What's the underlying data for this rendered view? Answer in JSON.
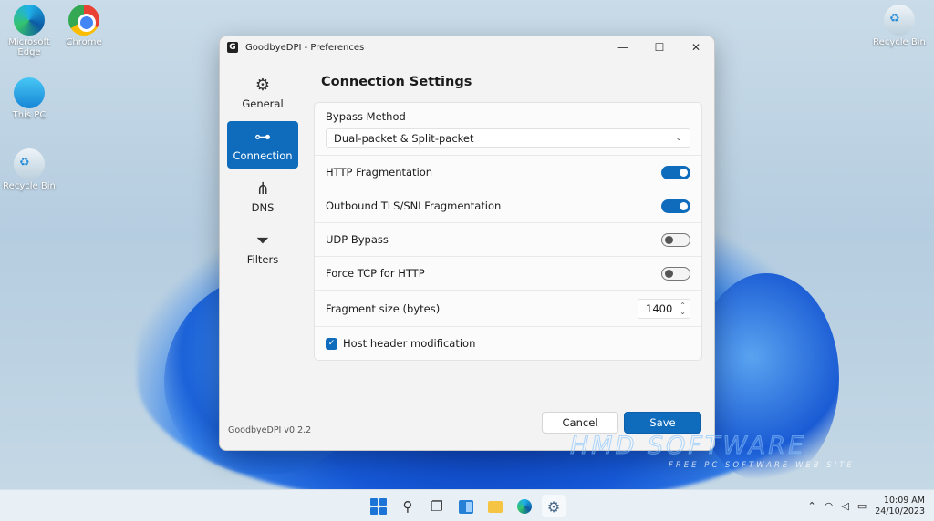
{
  "desktop": {
    "icons": [
      {
        "label": "Microsoft Edge"
      },
      {
        "label": "Chrome"
      },
      {
        "label": "This PC"
      },
      {
        "label": "Recycle Bin"
      },
      {
        "label": "Recycle Bin"
      }
    ]
  },
  "window": {
    "title": "GoodbyeDPI - Preferences",
    "app_icon_letter": "G",
    "controls": {
      "minimize": "—",
      "maximize": "☐",
      "close": "✕"
    }
  },
  "nav": {
    "items": [
      {
        "label": "General",
        "icon": "gear-icon",
        "glyph": "⚙",
        "active": false
      },
      {
        "label": "Connection",
        "icon": "connection-icon",
        "glyph": "⊶",
        "active": true
      },
      {
        "label": "DNS",
        "icon": "network-nodes-icon",
        "glyph": "⋔",
        "active": false
      },
      {
        "label": "Filters",
        "icon": "filter-icon",
        "glyph": "⏷",
        "active": false
      }
    ]
  },
  "version": "GoodbyeDPI v0.2.2",
  "connection": {
    "title": "Connection Settings",
    "bypass_method_label": "Bypass Method",
    "bypass_method_value": "Dual-packet & Split-packet",
    "toggles": [
      {
        "label": "HTTP Fragmentation",
        "on": true
      },
      {
        "label": "Outbound TLS/SNI Fragmentation",
        "on": true
      },
      {
        "label": "UDP Bypass",
        "on": false
      },
      {
        "label": "Force TCP for HTTP",
        "on": false
      }
    ],
    "fragment_size_label": "Fragment size (bytes)",
    "fragment_size_value": "1400",
    "host_header_label": "Host header modification",
    "host_header_checked": true
  },
  "buttons": {
    "cancel": "Cancel",
    "save": "Save"
  },
  "watermark": {
    "main": "HMD SOFTWARE",
    "sub": "FREE PC SOFTWARE WEB SITE"
  },
  "taskbar": {
    "time": "10:09 AM",
    "date": "24/10/2023",
    "tray_icons": [
      "chevron-up-icon",
      "wifi-icon",
      "volume-icon",
      "battery-icon"
    ]
  },
  "colors": {
    "accent": "#0f6cbd",
    "window_bg": "#f3f3f3"
  }
}
